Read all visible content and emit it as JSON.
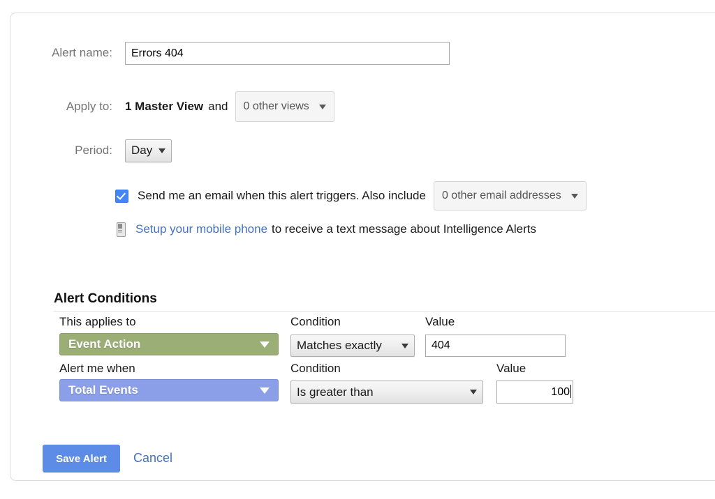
{
  "form": {
    "alert_name": {
      "label": "Alert name:",
      "value": "Errors 404"
    },
    "apply_to": {
      "label": "Apply to:",
      "primary_view": "1 Master View",
      "conjunction": "and",
      "other_views_value": "0 other views"
    },
    "period": {
      "label": "Period:",
      "value": "Day"
    },
    "email": {
      "checkbox_checked": true,
      "text_before": "Send me an email when this alert triggers. Also include",
      "addresses_value": "0 other email addresses"
    },
    "mobile": {
      "icon": "mobile-phone-icon",
      "link_text": "Setup your mobile phone",
      "text_after": "to receive a text message about Intelligence Alerts"
    }
  },
  "alert_conditions": {
    "title": "Alert Conditions",
    "columns": {
      "applies_to": "This applies to",
      "alert_me_when": "Alert me when",
      "condition_1": "Condition",
      "condition_2": "Condition",
      "value_1": "Value",
      "value_2": "Value"
    },
    "row1": {
      "dimension": "Event Action",
      "dimension_color": "#9bae76",
      "condition": "Matches exactly",
      "value": "404"
    },
    "row2": {
      "metric": "Total Events",
      "metric_color": "#8b9fe8",
      "condition": "Is greater than",
      "value": "100"
    }
  },
  "actions": {
    "save_label": "Save Alert",
    "cancel_label": "Cancel",
    "save_color": "#5c8ce6",
    "link_color": "#4470c4"
  }
}
